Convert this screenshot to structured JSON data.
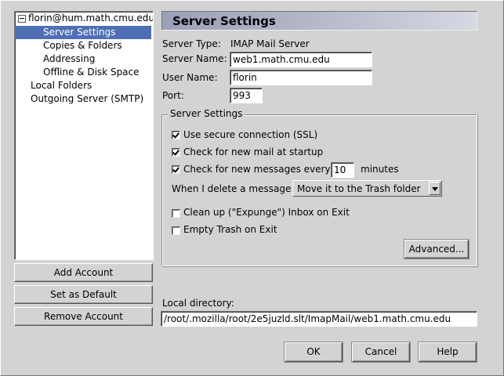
{
  "tree": {
    "account": "florin@hum.math.cmu.edu",
    "items": [
      {
        "label": "Server Settings",
        "selected": true
      },
      {
        "label": "Copies & Folders"
      },
      {
        "label": "Addressing"
      },
      {
        "label": "Offline & Disk Space"
      }
    ],
    "local_folders": "Local Folders",
    "outgoing": "Outgoing Server (SMTP)"
  },
  "left_buttons": {
    "add": "Add Account",
    "default": "Set as Default",
    "remove": "Remove Account"
  },
  "header": {
    "title": "Server Settings"
  },
  "server": {
    "type_label": "Server Type:",
    "type_value": "IMAP Mail Server",
    "name_label": "Server Name:",
    "name_value": "web1.math.cmu.edu",
    "user_label": "User Name:",
    "user_value": "florin",
    "port_label": "Port:",
    "port_value": "993"
  },
  "group": {
    "title": "Server Settings",
    "ssl": {
      "label": "Use secure connection (SSL)",
      "checked": true
    },
    "startup": {
      "label": "Check for new mail at startup",
      "checked": true
    },
    "every": {
      "label": "Check for new messages every",
      "checked": true,
      "value": "10",
      "unit": "minutes"
    },
    "delete_label": "When I delete a message:",
    "delete_value": "Move it to the Trash folder",
    "expunge": {
      "label": "Clean up (\"Expunge\") Inbox on Exit",
      "checked": false
    },
    "empty_trash": {
      "label": "Empty Trash on Exit",
      "checked": false
    },
    "advanced": "Advanced..."
  },
  "local_dir": {
    "label": "Local directory:",
    "value": "/root/.mozilla/root/2e5juzld.slt/ImapMail/web1.math.cmu.edu"
  },
  "dialog_buttons": {
    "ok": "OK",
    "cancel": "Cancel",
    "help": "Help"
  }
}
